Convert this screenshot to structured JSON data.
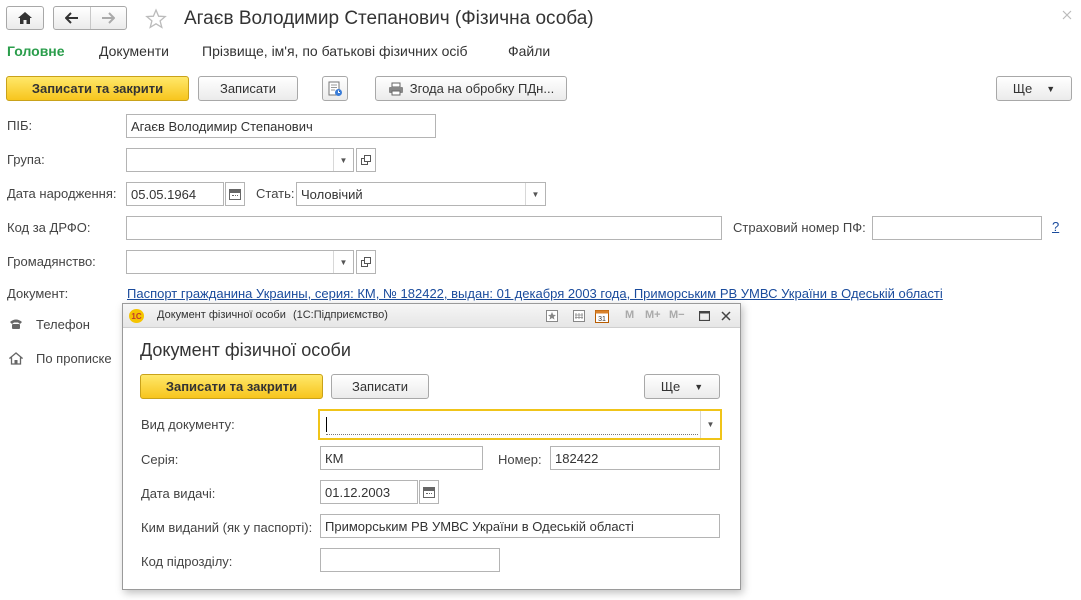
{
  "window": {
    "title": "Агаєв Володимир Степанович (Фізична особа)"
  },
  "tabs": [
    {
      "label": "Головне"
    },
    {
      "label": "Документи"
    },
    {
      "label": "Прізвище, ім'я, по батькові фізичних осіб"
    },
    {
      "label": "Файли"
    }
  ],
  "toolbar": {
    "save_close": "Записати та закрити",
    "save": "Записати",
    "consent": "Згода на обробку ПДн...",
    "more": "Ще"
  },
  "form": {
    "pib_label": "ПІБ:",
    "pib_value": "Агаєв Володимир Степанович",
    "group_label": "Група:",
    "group_value": "",
    "birth_label": "Дата народження:",
    "birth_value": "05.05.1964",
    "sex_label": "Стать:",
    "sex_value": "Чоловічий",
    "drfo_label": "Код за ДРФО:",
    "drfo_value": "",
    "insurance_label": "Страховий номер ПФ:",
    "insurance_value": "",
    "help": "?",
    "citizenship_label": "Громадянство:",
    "citizenship_value": "",
    "document_label": "Документ:",
    "document_link": "Паспорт гражданина Украины, серия: КМ, № 182422, выдан: 01 декабря 2003 года, Приморським РВ УМВС України в Одеській області",
    "phone_label": "Телефон",
    "address_label": "По прописке"
  },
  "dialog": {
    "title": "Документ фізичної особи",
    "app": "(1С:Підприємство)",
    "logo": "1С",
    "heading": "Документ фізичної особи",
    "save_close": "Записати та закрити",
    "save": "Записати",
    "more": "Ще",
    "doc_type_label": "Вид документу:",
    "doc_type_value": "",
    "series_label": "Серія:",
    "series_value": "КМ",
    "number_label": "Номер:",
    "number_value": "182422",
    "issue_date_label": "Дата видачі:",
    "issue_date_value": "01.12.2003",
    "issued_by_label": "Ким виданий (як у паспорті):",
    "issued_by_value": "Приморським РВ УМВС України в Одеській області",
    "dept_code_label": "Код підрозділу:",
    "dept_code_value": "",
    "icons": {
      "m": "M",
      "m_plus": "M+",
      "m_minus": "M−"
    }
  },
  "colors": {
    "active_tab": "#2a9d4b",
    "primary_button": "#f7c51d",
    "link": "#1a4b9c",
    "focus": "#f0c419"
  }
}
